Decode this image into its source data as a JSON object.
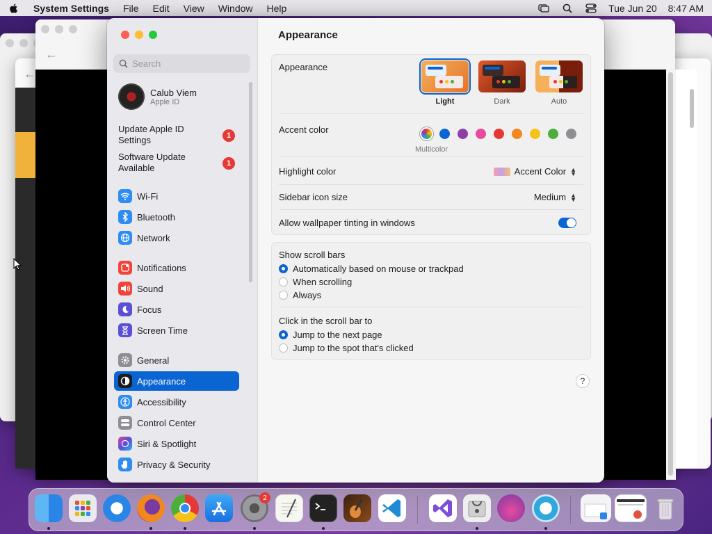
{
  "menubar": {
    "app_name": "System Settings",
    "menus": [
      "File",
      "Edit",
      "View",
      "Window",
      "Help"
    ],
    "date": "Tue Jun 20",
    "time": "8:47 AM"
  },
  "sidebar": {
    "search_placeholder": "Search",
    "profile_name": "Calub Viem",
    "profile_sub": "Apple ID",
    "notices": [
      {
        "label": "Update Apple ID Settings",
        "badge": "1"
      },
      {
        "label": "Software Update Available",
        "badge": "1"
      }
    ],
    "items": [
      {
        "label": "Wi-Fi",
        "icon": "wifi-icon",
        "color": "#2f8cf3"
      },
      {
        "label": "Bluetooth",
        "icon": "bluetooth-icon",
        "color": "#2f8cf3"
      },
      {
        "label": "Network",
        "icon": "globe-icon",
        "color": "#2f8cf3"
      },
      {
        "label": "Notifications",
        "icon": "bell-icon",
        "color": "#f0443c"
      },
      {
        "label": "Sound",
        "icon": "speaker-icon",
        "color": "#f0443c"
      },
      {
        "label": "Focus",
        "icon": "moon-icon",
        "color": "#5b4fd6"
      },
      {
        "label": "Screen Time",
        "icon": "hourglass-icon",
        "color": "#5b4fd6"
      },
      {
        "label": "General",
        "icon": "gear-icon",
        "color": "#8e8e93"
      },
      {
        "label": "Appearance",
        "icon": "appearance-icon",
        "color": "#1c1c1e"
      },
      {
        "label": "Accessibility",
        "icon": "accessibility-icon",
        "color": "#2f8cf3"
      },
      {
        "label": "Control Center",
        "icon": "control-center-icon",
        "color": "#8e8e93"
      },
      {
        "label": "Siri & Spotlight",
        "icon": "siri-icon",
        "color": "#7a4fd8"
      },
      {
        "label": "Privacy & Security",
        "icon": "hand-icon",
        "color": "#2f8cf3"
      }
    ],
    "active": "Appearance"
  },
  "content": {
    "title": "Appearance",
    "appearance_label": "Appearance",
    "appearance_options": [
      "Light",
      "Dark",
      "Auto"
    ],
    "appearance_selected": "Light",
    "accent_label": "Accent color",
    "accent_colors": [
      "multicolor",
      "#0a64d2",
      "#8e3fa8",
      "#e84aa0",
      "#e53935",
      "#f0871f",
      "#f5c11a",
      "#4caf3c",
      "#8e8e93"
    ],
    "accent_selected_label": "Multicolor",
    "highlight_label": "Highlight color",
    "highlight_value": "Accent Color",
    "sidebar_icon_label": "Sidebar icon size",
    "sidebar_icon_value": "Medium",
    "tinting_label": "Allow wallpaper tinting in windows",
    "tinting_on": true,
    "scroll_bars_label": "Show scroll bars",
    "scroll_bars_options": [
      "Automatically based on mouse or trackpad",
      "When scrolling",
      "Always"
    ],
    "scroll_bars_selected": "Automatically based on mouse or trackpad",
    "click_label": "Click in the scroll bar to",
    "click_options": [
      "Jump to the next page",
      "Jump to the spot that's clicked"
    ],
    "click_selected": "Jump to the next page",
    "help": "?"
  },
  "dock": {
    "settings_badge": "2",
    "apps": [
      "finder-icon",
      "launchpad-icon",
      "safari-icon",
      "firefox-icon",
      "chrome-icon",
      "app-store-icon",
      "system-settings-icon",
      "textedit-icon",
      "terminal-icon",
      "garageband-icon",
      "vscode-icon",
      "visual-studio-icon",
      "disk-utility-icon",
      "installer-icon",
      "screen-recorder-icon",
      "downloads-icon",
      "preview-icon",
      "trash-icon"
    ]
  }
}
